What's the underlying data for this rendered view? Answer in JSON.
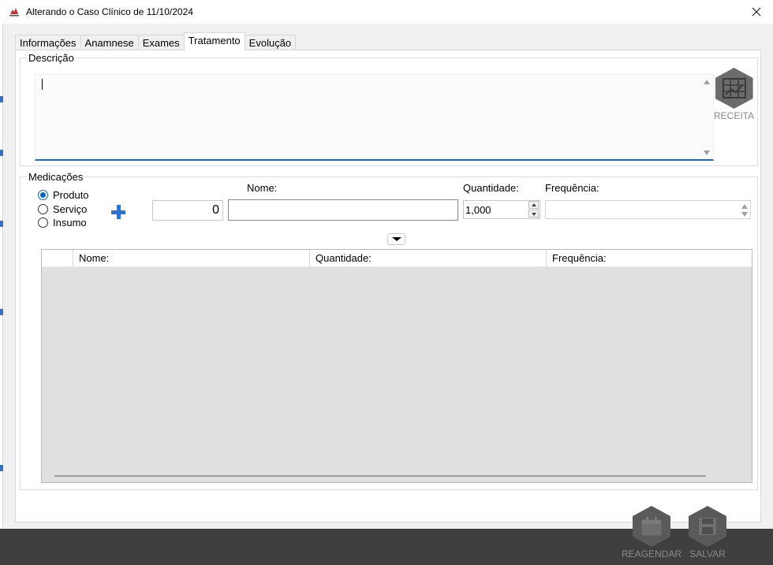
{
  "window": {
    "title": "Alterando o Caso Clínico de 11/10/2024",
    "app_icon": "pet-shop-logo-icon",
    "close_icon": "close-icon"
  },
  "tabs": [
    {
      "label": "Informações",
      "active": false
    },
    {
      "label": "Anamnese",
      "active": false
    },
    {
      "label": "Exames",
      "active": false
    },
    {
      "label": "Tratamento",
      "active": true
    },
    {
      "label": "Evolução",
      "active": false
    }
  ],
  "descricao": {
    "title": "Descrição",
    "value": ""
  },
  "receita": {
    "label": "RECEITA",
    "icon": "prescription-chart-icon"
  },
  "medicacoes": {
    "title": "Medicações",
    "types": [
      {
        "label": "Produto",
        "checked": true
      },
      {
        "label": "Serviço",
        "checked": false
      },
      {
        "label": "Insumo",
        "checked": false
      }
    ],
    "add_icon": "plus-icon",
    "code_value": "0",
    "nome_label": "Nome:",
    "nome_value": "",
    "quantidade_label": "Quantidade:",
    "quantidade_value": "1,000",
    "frequencia_label": "Frequência:",
    "frequencia_value": ""
  },
  "table": {
    "columns": [
      "Nome:",
      "Quantidade:",
      "Frequência:"
    ],
    "rows": []
  },
  "footer": {
    "reagendar_label": "REAGENDAR",
    "reagendar_icon": "calendar-icon",
    "salvar_label": "SALVAR",
    "salvar_icon": "floppy-disk-icon"
  },
  "colors": {
    "accent": "#1f6bb1",
    "radio_selected": "#0067c0",
    "plus": "#2f73d0",
    "hex_button": "#6b6b6b",
    "footer_bg": "#3f3f3f"
  }
}
